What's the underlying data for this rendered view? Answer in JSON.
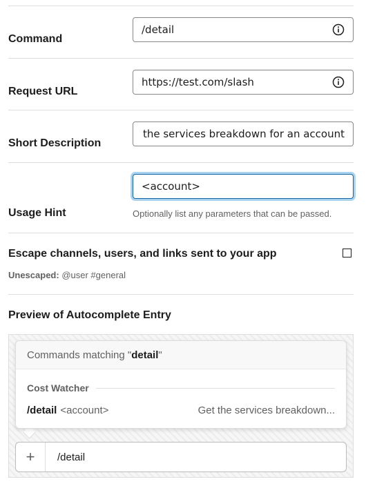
{
  "form": {
    "command": {
      "label": "Command",
      "value": "/detail",
      "info_icon": "info-icon"
    },
    "request_url": {
      "label": "Request URL",
      "value": "https://test.com/slash",
      "info_icon": "info-icon"
    },
    "short_description": {
      "label": "Short Description",
      "value": "Get the services breakdown for an account"
    },
    "usage_hint": {
      "label": "Usage Hint",
      "value": "<account>",
      "helper": "Optionally list any parameters that can be passed."
    },
    "escape": {
      "label": "Escape channels, users, and links sent to your app",
      "checked": false,
      "status_label": "Unescaped:",
      "status_example": "@user #general"
    }
  },
  "preview": {
    "title": "Preview of Autocomplete Entry",
    "popup": {
      "heading_prefix": "Commands matching \"",
      "heading_query": "detail",
      "heading_suffix": "\"",
      "app_name": "Cost Watcher",
      "command_name": "/detail",
      "command_hint": "<account>",
      "command_description": "Get the services breakdown..."
    },
    "composer": {
      "plus_icon": "+",
      "text": "/detail"
    }
  },
  "colors": {
    "focus_border": "#1264a3",
    "focus_glow": "#a9d3ef",
    "muted_text": "#616061",
    "text": "#1d1c1d"
  }
}
